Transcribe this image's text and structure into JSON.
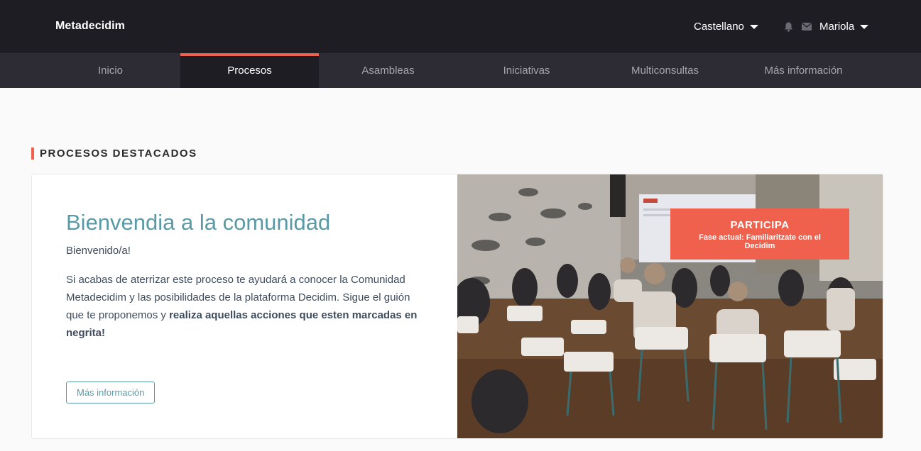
{
  "header": {
    "logo": "Metadecidim",
    "language": "Castellano",
    "user": "Mariola"
  },
  "nav": {
    "items": [
      {
        "label": "Inicio"
      },
      {
        "label": "Procesos"
      },
      {
        "label": "Asambleas"
      },
      {
        "label": "Iniciativas"
      },
      {
        "label": "Multiconsultas"
      },
      {
        "label": "Más información"
      }
    ],
    "active_index": 1
  },
  "section": {
    "title": "PROCESOS DESTACADOS"
  },
  "featured": {
    "title": "Bienvendia a la comunidad",
    "subtitle": "Bienvenido/a!",
    "description_plain": "Si acabas de aterrizar este proceso te ayudará a conocer la Comunidad Metadecidim y las posibilidades de la plataforma Decidim. Sigue el guión que te proponemos y ",
    "description_bold": "realiza aquellas acciones que esten marcadas en negrita!",
    "more_button": "Más información",
    "participa_label": "PARTICIPA",
    "phase_label": "Fase actual: Familiaritzate con el Decidim"
  },
  "colors": {
    "accent": "#ef604d",
    "teal": "#599aa6",
    "topbar": "#1f1d24",
    "navbar": "#2d2b33"
  },
  "icons": [
    "bell-icon",
    "mail-icon",
    "caret-down-icon"
  ]
}
